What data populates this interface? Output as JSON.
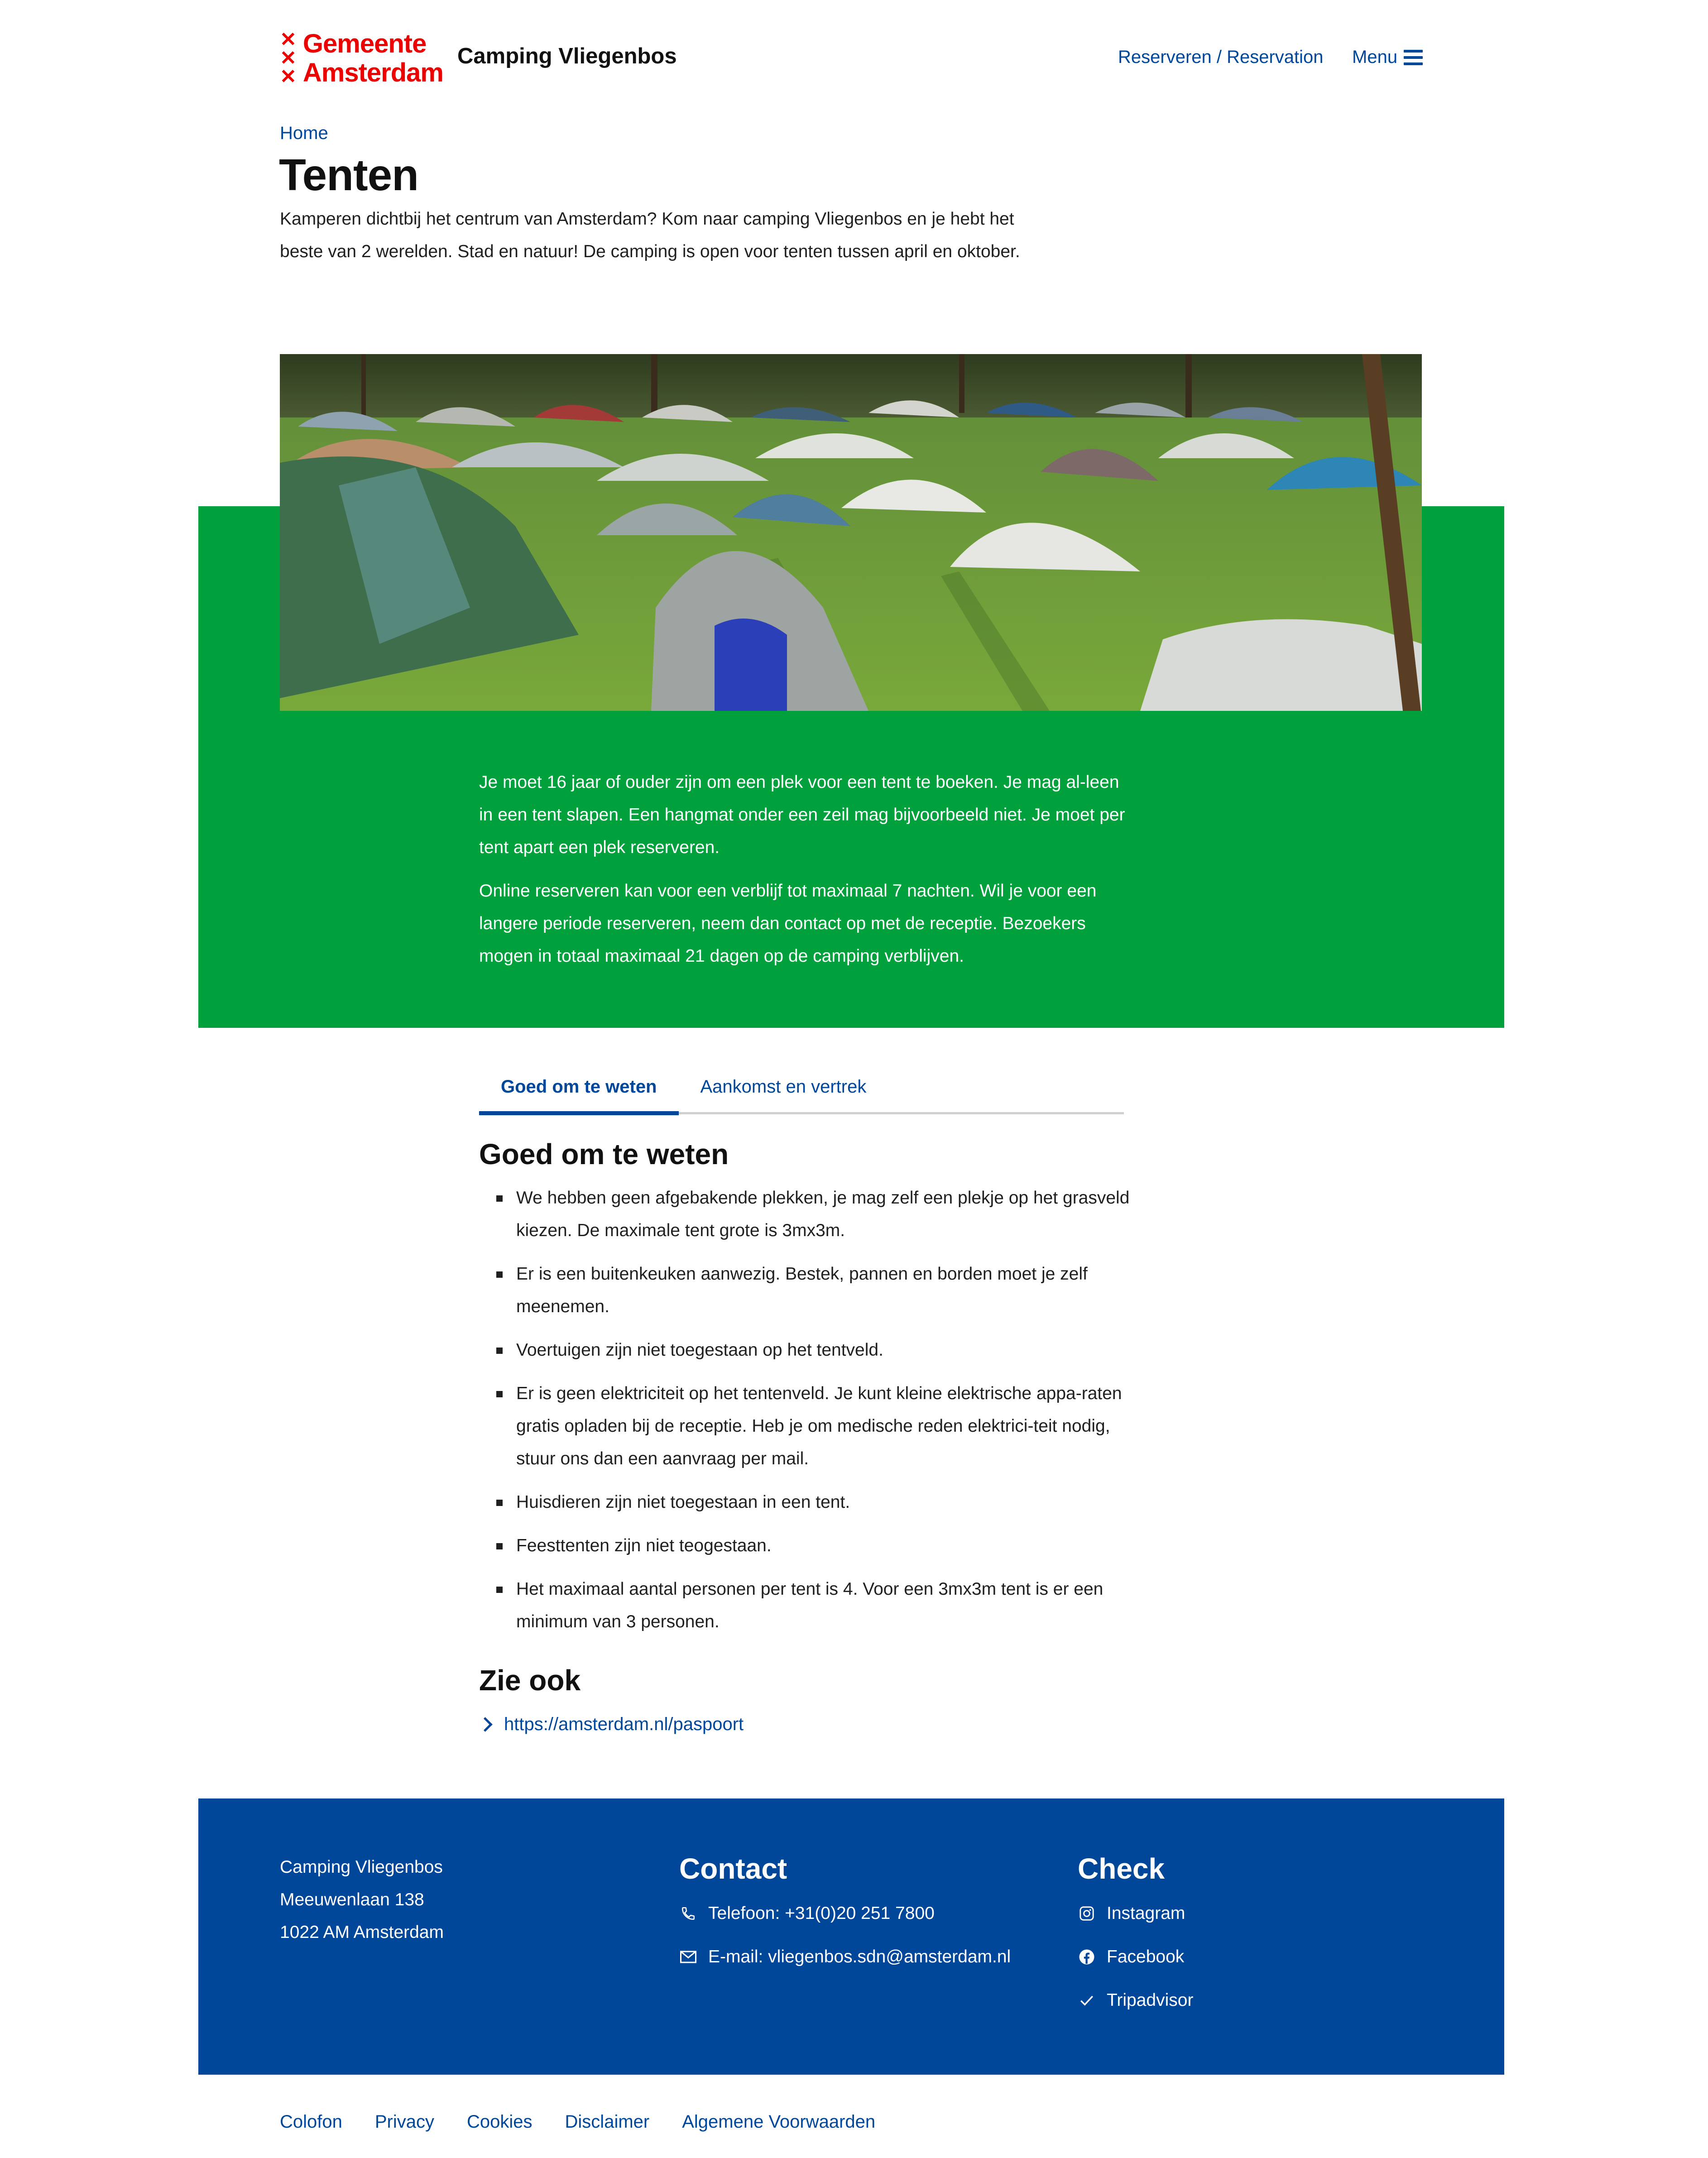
{
  "header": {
    "logo_line1": "Gemeente",
    "logo_line2": "Amsterdam",
    "site_title": "Camping Vliegenbos",
    "nav_reserve": "Reserveren / Reservation",
    "nav_menu": "Menu"
  },
  "breadcrumb": {
    "home": "Home"
  },
  "page": {
    "title": "Tenten",
    "intro": "Kamperen dichtbij het centrum van Amsterdam? Kom naar camping Vliegenbos en je hebt het beste van 2 werelden. Stad en natuur! De camping is open voor tenten tussen april en oktober."
  },
  "green": {
    "p1": "Je moet 16 jaar of ouder zijn om een plek voor een tent te boeken. Je mag al-leen in een tent slapen. Een hangmat onder een zeil mag bijvoorbeeld niet. Je moet per tent apart een plek reserveren.",
    "p2": "Online reserveren kan voor een verblijf tot maximaal 7 nachten. Wil je voor een langere periode reserveren, neem dan contact op met de receptie. Bezoekers mogen in totaal maximaal 21 dagen op de camping verblijven."
  },
  "tabs": [
    {
      "label": "Goed om te weten"
    },
    {
      "label": "Aankomst en vertrek"
    }
  ],
  "section": {
    "title": "Goed om te weten",
    "bullets": [
      "We hebben geen afgebakende plekken, je mag zelf een plekje op het grasveld kiezen. De maximale tent grote is 3mx3m.",
      "Er is een buitenkeuken aanwezig. Bestek, pannen en borden moet je zelf meenemen.",
      "Voertuigen zijn niet toegestaan op het tentveld.",
      "Er is geen elektriciteit op het tentenveld. Je kunt kleine elektrische appa-raten gratis opladen bij de receptie. Heb je om medische reden elektrici-teit nodig, stuur ons dan een aanvraag per mail.",
      "Huisdieren zijn niet toegestaan in een tent.",
      "Feesttenten zijn niet teogestaan.",
      "Het maximaal aantal personen per tent is 4. Voor een 3mx3m tent is er een minimum van 3 personen."
    ]
  },
  "see_also": {
    "title": "Zie ook",
    "link": "https://amsterdam.nl/paspoort"
  },
  "footer": {
    "address": [
      "Camping Vliegenbos",
      "Meeuwenlaan 138",
      "1022 AM Amsterdam"
    ],
    "contact_title": "Contact",
    "phone": "Telefoon: +31(0)20 251 7800",
    "email": "E-mail: vliegenbos.sdn@amsterdam.nl",
    "check_title": "Check",
    "instagram": "Instagram",
    "facebook": "Facebook",
    "tripadvisor": "Tripadvisor"
  },
  "bottom_links": [
    "Colofon",
    "Privacy",
    "Cookies",
    "Disclaimer",
    "Algemene Voorwaarden"
  ],
  "colors": {
    "brand_red": "#ec0000",
    "brand_blue": "#004699",
    "brand_green": "#00a03c"
  }
}
